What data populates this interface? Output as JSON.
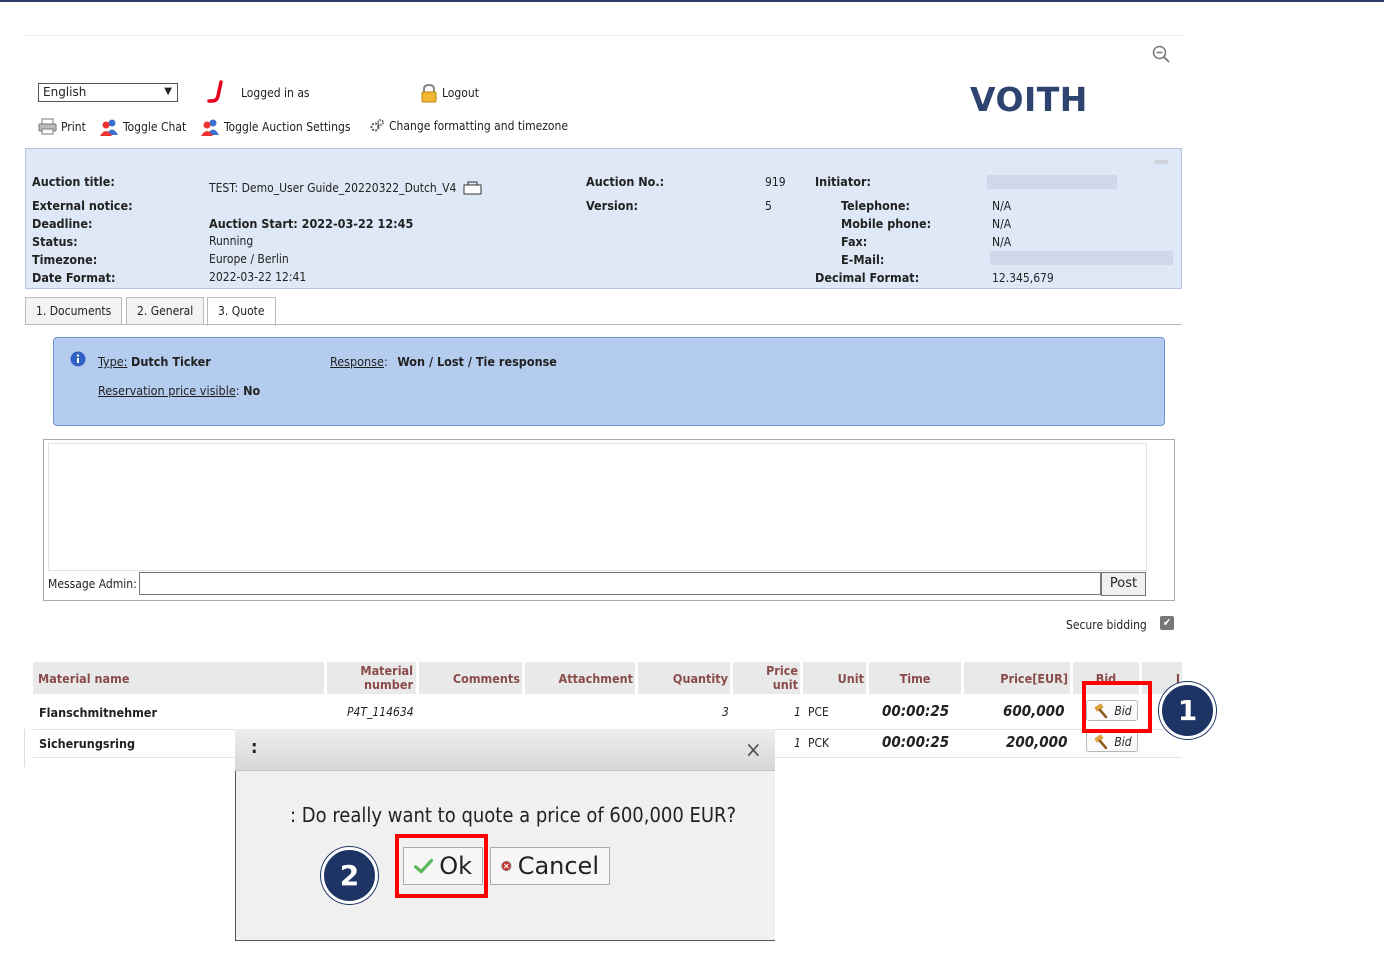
{
  "header": {
    "language_selected": "English",
    "logged_in_label": "Logged in as",
    "logout_label": "Logout",
    "brand": "VOITH"
  },
  "toolbar": {
    "print": "Print",
    "toggle_chat": "Toggle Chat",
    "toggle_settings": "Toggle Auction Settings",
    "change_formatting": "Change formatting and timezone"
  },
  "auction": {
    "labels": {
      "title": "Auction title:",
      "external_notice": "External notice:",
      "deadline": "Deadline:",
      "status": "Status:",
      "timezone": "Timezone:",
      "date_format": "Date Format:",
      "auction_no": "Auction No.:",
      "version": "Version:",
      "initiator": "Initiator:",
      "telephone": "Telephone:",
      "mobile": "Mobile phone:",
      "fax": "Fax:",
      "email": "E-Mail:",
      "decimal_format": "Decimal Format:"
    },
    "title": "TEST: Demo_User Guide_20220322_Dutch_V4",
    "deadline": "Auction Start: 2022-03-22 12:45",
    "status": "Running",
    "timezone": "Europe / Berlin",
    "date_format": "2022-03-22 12:41",
    "auction_no": "919",
    "version": "5",
    "telephone": "N/A",
    "mobile": "N/A",
    "fax": "N/A",
    "decimal_format": "12.345,679"
  },
  "tabs": [
    "1. Documents",
    "2. General",
    "3. Quote"
  ],
  "notice": {
    "type_label": "Type:",
    "type_value": "Dutch Ticker",
    "response_label": "Response",
    "response_value": "Won / Lost / Tie response",
    "reservation_label": "Reservation price visible",
    "reservation_value": "No"
  },
  "chat": {
    "message_label": "Message Admin:",
    "post_label": "Post"
  },
  "secure_bidding": "Secure bidding",
  "table": {
    "headers": {
      "material_name": "Material name",
      "material_number_1": "Material",
      "material_number_2": "number",
      "comments": "Comments",
      "attachment": "Attachment",
      "quantity": "Quantity",
      "price_unit_1": "Price",
      "price_unit_2": "unit",
      "unit": "Unit",
      "time": "Time",
      "price": "Price[EUR]",
      "bid": "Bid",
      "extra": "I"
    },
    "rows": [
      {
        "name": "Flanschmitnehmer",
        "number": "P4T_114634",
        "quantity": "3",
        "price_unit": "1",
        "unit": "PCE",
        "time": "00:00:25",
        "price": "600,000",
        "bid": "Bid"
      },
      {
        "name": "Sicherungsring",
        "price_unit": "1",
        "unit": "PCK",
        "time": "00:00:25",
        "price": "200,000",
        "bid": "Bid"
      }
    ]
  },
  "dialog": {
    "title": ":",
    "close": "×",
    "message": ": Do really want to quote a price of 600,000 EUR?",
    "ok": "Ok",
    "cancel": "Cancel"
  },
  "annotations": {
    "step1": "1",
    "step2": "2"
  }
}
